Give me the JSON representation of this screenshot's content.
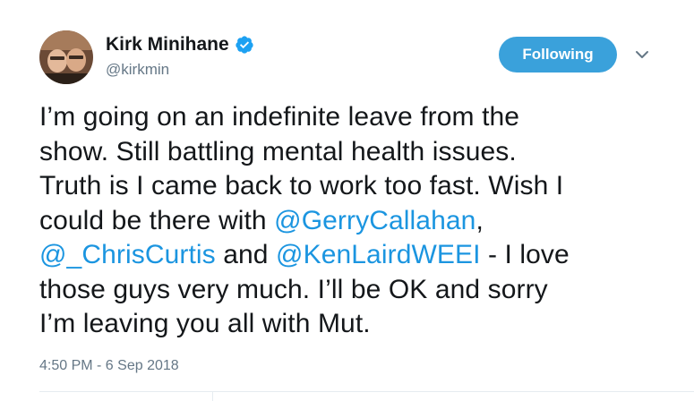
{
  "author": {
    "display_name": "Kirk Minihane",
    "handle": "@kirkmin",
    "verified": true
  },
  "follow_button": {
    "label": "Following"
  },
  "tweet": {
    "lines": [
      [
        {
          "text": "I’m going on an indefinite leave from the"
        }
      ],
      [
        {
          "text": "show. Still battling mental health issues."
        }
      ],
      [
        {
          "text": "Truth is I came back to work too fast. Wish I"
        }
      ],
      [
        {
          "text": "could be there with "
        },
        {
          "text": "@GerryCallahan",
          "mention": true
        },
        {
          "text": ","
        }
      ],
      [
        {
          "text": "@_ChrisCurtis",
          "mention": true
        },
        {
          "text": " and "
        },
        {
          "text": "@KenLairdWEEI",
          "mention": true
        },
        {
          "text": " - I love"
        }
      ],
      [
        {
          "text": "those guys very much. I’ll be OK and sorry"
        }
      ],
      [
        {
          "text": "I’m leaving you all with Mut."
        }
      ]
    ],
    "timestamp": "4:50 PM - 6 Sep 2018"
  },
  "icons": {
    "verified": "verified-badge-icon",
    "chevron": "chevron-down-icon"
  },
  "colors": {
    "follow_button_bg": "#3aa1db",
    "mention": "#1b95e0",
    "secondary_text": "#657786",
    "verified_badge": "#1da1f2"
  }
}
